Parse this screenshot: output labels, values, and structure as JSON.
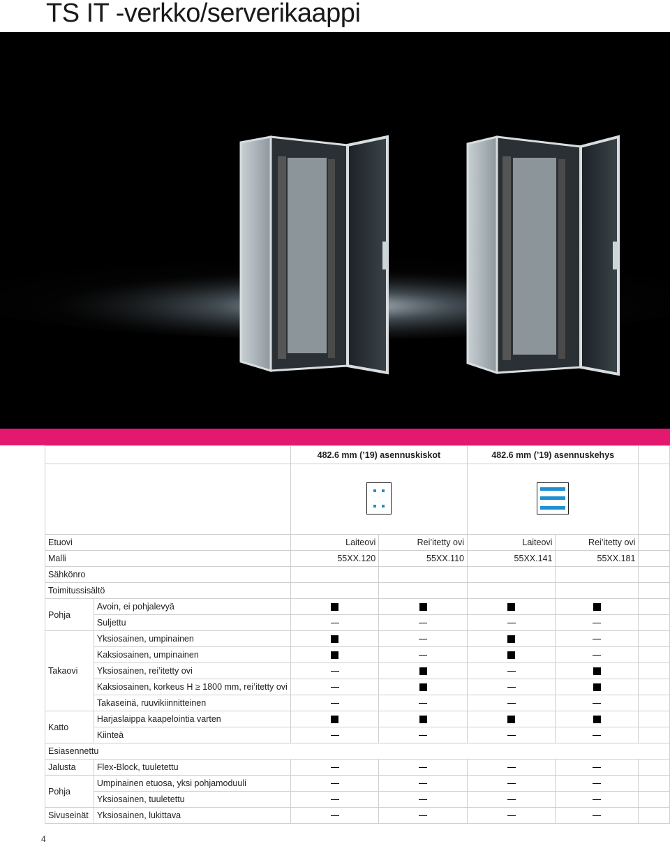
{
  "page": {
    "title": "TS IT -verkko/serverikaappi",
    "page_number": "4"
  },
  "header": {
    "group_1": "482.6 mm (’19) asennuskiskot",
    "group_2": "482.6 mm (’19) asennuskehys",
    "group_1_icon": "rail-icon",
    "group_2_icon": "frame-icon"
  },
  "spec_rows": {
    "etuovi": {
      "label": "Etuovi",
      "values": [
        "Laiteovi",
        "Rei’itetty ovi",
        "Laiteovi",
        "Rei’itetty ovi"
      ]
    },
    "malli": {
      "label": "Malli",
      "values": [
        "55XX.120",
        "55XX.110",
        "55XX.141",
        "55XX.181"
      ]
    },
    "sahkonro": {
      "label": "Sähkönro"
    },
    "toimitus": {
      "label": "Toimitussisältö"
    }
  },
  "groups": [
    {
      "name": "Pohja",
      "rows": [
        {
          "label": "Avoin, ei pohjalevyä",
          "marks": [
            "square",
            "square",
            "square",
            "square"
          ]
        },
        {
          "label": "Suljettu",
          "marks": [
            "dash",
            "dash",
            "dash",
            "dash"
          ]
        }
      ]
    },
    {
      "name": "Takaovi",
      "rows": [
        {
          "label": "Yksiosainen, umpinainen",
          "marks": [
            "square",
            "dash",
            "square",
            "dash"
          ]
        },
        {
          "label": "Kaksiosainen, umpinainen",
          "marks": [
            "square",
            "dash",
            "square",
            "dash"
          ]
        },
        {
          "label": "Yksiosainen, rei’itetty ovi",
          "marks": [
            "dash",
            "square",
            "dash",
            "square"
          ]
        },
        {
          "label": "Kaksiosainen, korkeus H ≥ 1800 mm, rei’itetty ovi",
          "marks": [
            "dash",
            "square",
            "dash",
            "square"
          ]
        },
        {
          "label": "Takaseinä, ruuvikiinnitteinen",
          "marks": [
            "dash",
            "dash",
            "dash",
            "dash"
          ]
        }
      ]
    },
    {
      "name": "Katto",
      "rows": [
        {
          "label": "Harjaslaippa kaapelointia varten",
          "marks": [
            "square",
            "square",
            "square",
            "square"
          ]
        },
        {
          "label": "Kiinteä",
          "marks": [
            "dash",
            "dash",
            "dash",
            "dash"
          ]
        }
      ]
    }
  ],
  "esiasennettu": {
    "label": "Esiasennettu"
  },
  "groups2": [
    {
      "name": "Jalusta",
      "rows": [
        {
          "label": "Flex-Block, tuuletettu",
          "marks": [
            "dash",
            "dash",
            "dash",
            "dash"
          ]
        }
      ]
    },
    {
      "name": "Pohja",
      "rows": [
        {
          "label": "Umpinainen etuosa, yksi pohjamoduuli",
          "marks": [
            "dash",
            "dash",
            "dash",
            "dash"
          ]
        },
        {
          "label": "Yksiosainen, tuuletettu",
          "marks": [
            "dash",
            "dash",
            "dash",
            "dash"
          ]
        }
      ]
    },
    {
      "name": "Sivuseinät",
      "rows": [
        {
          "label": "Yksiosainen, lukittava",
          "marks": [
            "dash",
            "dash",
            "dash",
            "dash"
          ]
        }
      ]
    }
  ],
  "colors": {
    "accent": "#e5186f",
    "icon_blue": "#1e90d0",
    "photo_bg": "#000000"
  }
}
